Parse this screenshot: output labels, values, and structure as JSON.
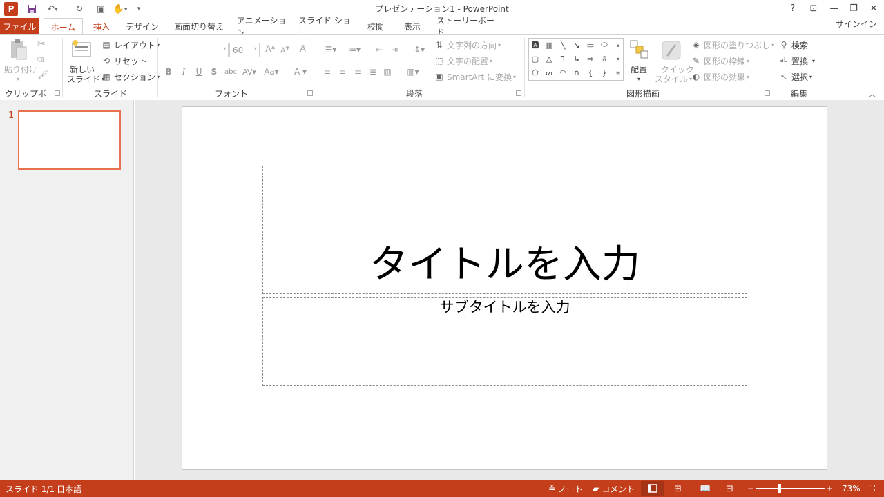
{
  "window": {
    "title": "プレゼンテーション1 - PowerPoint",
    "app_icon_label": "P"
  },
  "tabs": [
    "ファイル",
    "ホーム",
    "挿入",
    "デザイン",
    "画面切り替え",
    "アニメーション",
    "スライド ショー",
    "校閲",
    "表示",
    "ストーリーボード"
  ],
  "signin": "サインイン",
  "ribbon": {
    "clipboard": {
      "paste": "貼り付け",
      "label": "クリップボード"
    },
    "slides": {
      "new_slide_line1": "新しい",
      "new_slide_line2": "スライド",
      "layout": "レイアウト",
      "reset": "リセット",
      "section": "セクション",
      "label": "スライド"
    },
    "font": {
      "size": "60",
      "label": "フォント"
    },
    "paragraph": {
      "text_direction": "文字列の方向",
      "align_text": "文字の配置",
      "smartart": "SmartArt に変換",
      "label": "段落"
    },
    "drawing": {
      "arrange": "配置",
      "quick_styles_line1": "クイック",
      "quick_styles_line2": "スタイル",
      "shape_fill": "図形の塗りつぶし",
      "shape_outline": "図形の枠線",
      "shape_effects": "図形の効果",
      "label": "図形描画"
    },
    "editing": {
      "find": "検索",
      "replace": "置換",
      "select": "選択",
      "label": "編集"
    }
  },
  "thumbnail": {
    "number": "1"
  },
  "slide": {
    "title_placeholder": "タイトルを入力",
    "subtitle_placeholder": "サブタイトルを入力"
  },
  "status": {
    "slide_count": "スライド 1/1",
    "language": "日本語",
    "notes": "ノート",
    "comments": "コメント",
    "zoom": "73%",
    "zoom_level": 0.73
  },
  "colors": {
    "accent": "#c43e1c",
    "thumb_border": "#e8714e"
  }
}
